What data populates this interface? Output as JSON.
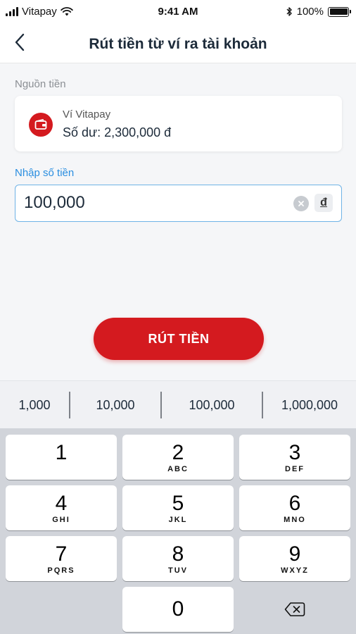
{
  "status_bar": {
    "carrier": "Vitapay",
    "time": "9:41 AM",
    "battery_percent": "100%"
  },
  "header": {
    "title": "Rút tiền từ ví ra tài khoản",
    "back_icon": "chevron-left-icon"
  },
  "source": {
    "label": "Nguồn tiền",
    "wallet_name": "Ví Vitapay",
    "balance": "Số dư: 2,300,000 đ",
    "icon": "wallet-icon"
  },
  "amount": {
    "label": "Nhập số tiền",
    "value": "100,000",
    "currency": "đ",
    "clear_icon": "clear-icon"
  },
  "actions": {
    "withdraw_label": "RÚT TIỀN"
  },
  "quick_amounts": [
    "1,000",
    "10,000",
    "100,000",
    "1,000,000"
  ],
  "keypad": {
    "keys": [
      {
        "digit": "1",
        "letters": ""
      },
      {
        "digit": "2",
        "letters": "ABC"
      },
      {
        "digit": "3",
        "letters": "DEF"
      },
      {
        "digit": "4",
        "letters": "GHI"
      },
      {
        "digit": "5",
        "letters": "JKL"
      },
      {
        "digit": "6",
        "letters": "MNO"
      },
      {
        "digit": "7",
        "letters": "PQRS"
      },
      {
        "digit": "8",
        "letters": "TUV"
      },
      {
        "digit": "9",
        "letters": "WXYZ"
      }
    ],
    "zero": "0",
    "delete_icon": "backspace-icon"
  },
  "colors": {
    "brand_red": "#d41a1f",
    "accent_blue": "#2a8ee0",
    "keypad_bg": "#d1d4da"
  }
}
